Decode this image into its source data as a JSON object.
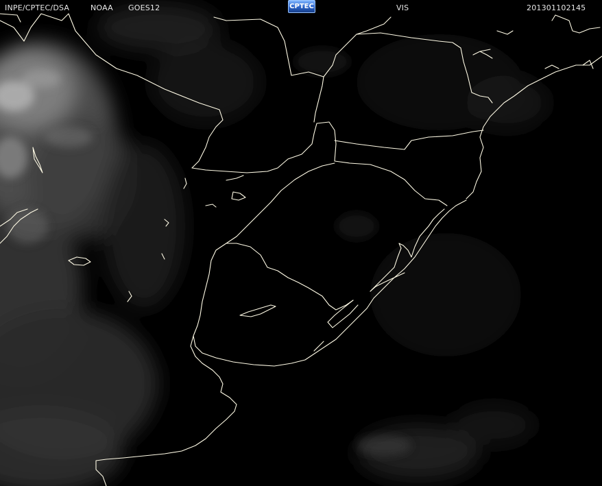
{
  "header": {
    "institution": "INPE/CPTEC/DSA",
    "agency": "NOAA",
    "satellite": "GOES12",
    "channel": "VIS",
    "timestamp": "201301102145"
  },
  "logo": {
    "text": "CPTEC",
    "color": "#2a63c9"
  },
  "imagery": {
    "type": "satellite visible channel",
    "background": "#000000",
    "coastline_color": "#fffbe6"
  }
}
